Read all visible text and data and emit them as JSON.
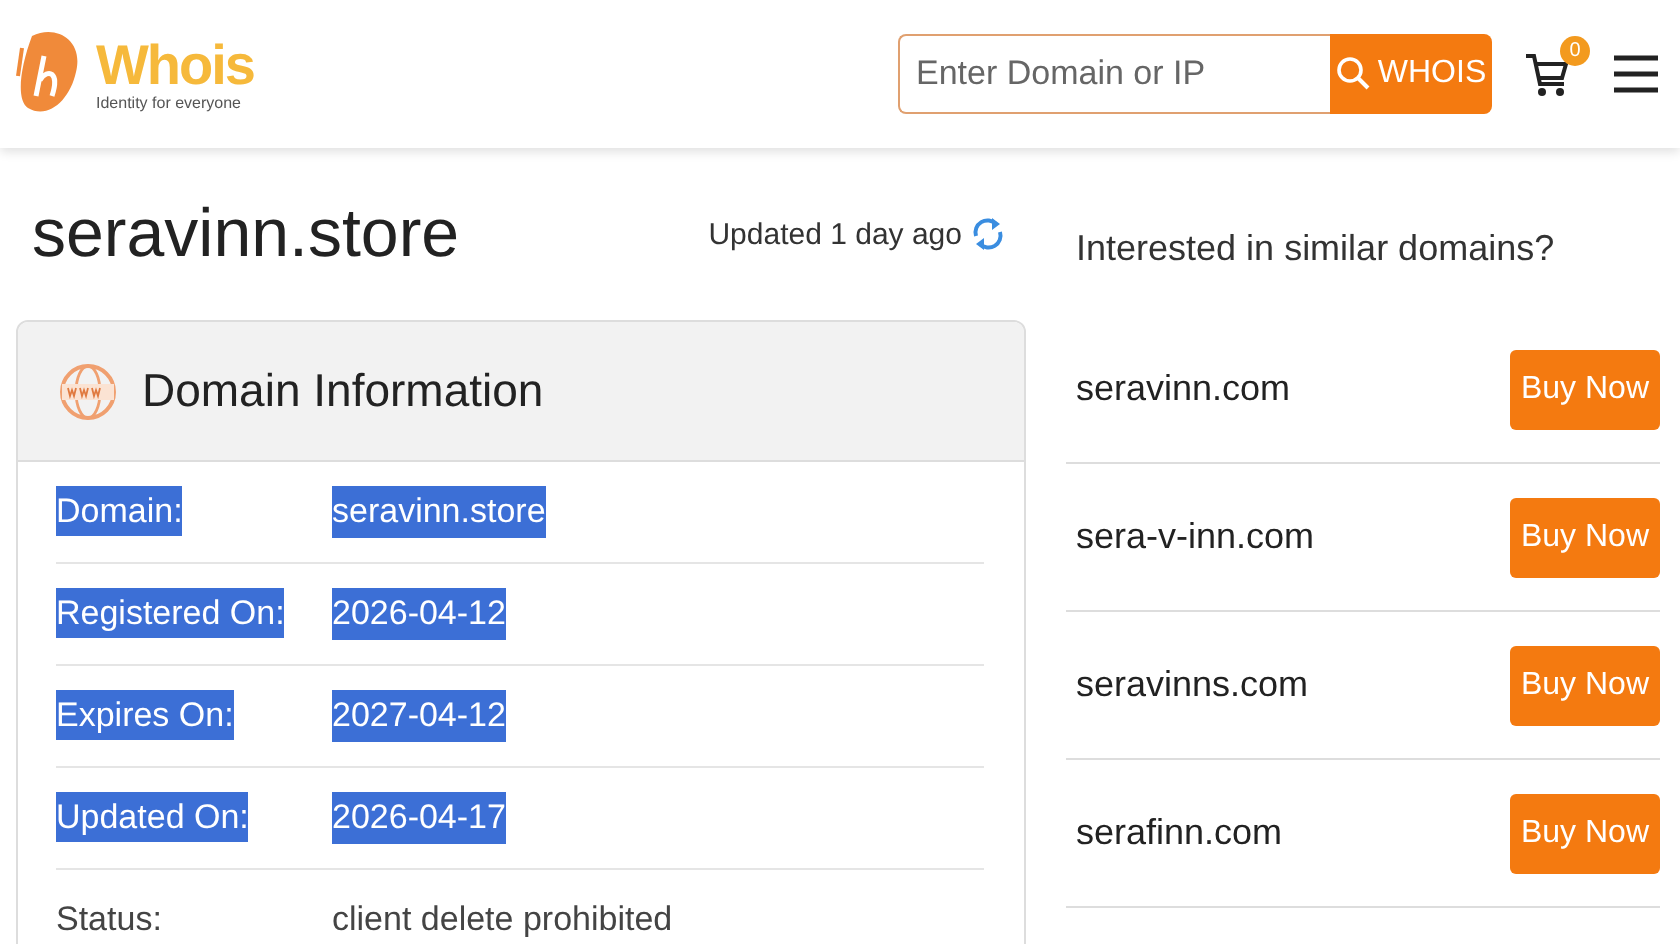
{
  "header": {
    "logo": {
      "name": "Whois",
      "tagline": "Identity for everyone"
    },
    "search": {
      "placeholder": "Enter Domain or IP",
      "button": "WHOIS"
    },
    "cart_count": "0"
  },
  "domain_title": "seravinn.store",
  "updated": "Updated 1 day ago",
  "domain_information": {
    "title": "Domain Information",
    "rows": [
      {
        "label": "Domain:",
        "value": "seravinn.store",
        "selected": true
      },
      {
        "label": "Registered On:",
        "value": "2026-04-12",
        "selected": true
      },
      {
        "label": "Expires On:",
        "value": "2027-04-12",
        "selected": true
      },
      {
        "label": "Updated On:",
        "value": "2026-04-17",
        "selected": true
      },
      {
        "label": "Status:",
        "value": "client delete prohibited",
        "selected": false
      }
    ]
  },
  "similar_domains": {
    "title": "Interested in similar domains?",
    "items": [
      {
        "domain": "seravinn.com",
        "button": "Buy Now"
      },
      {
        "domain": "sera-v-inn.com",
        "button": "Buy Now"
      },
      {
        "domain": "seravinns.com",
        "button": "Buy Now"
      },
      {
        "domain": "serafinn.com",
        "button": "Buy Now"
      }
    ]
  }
}
